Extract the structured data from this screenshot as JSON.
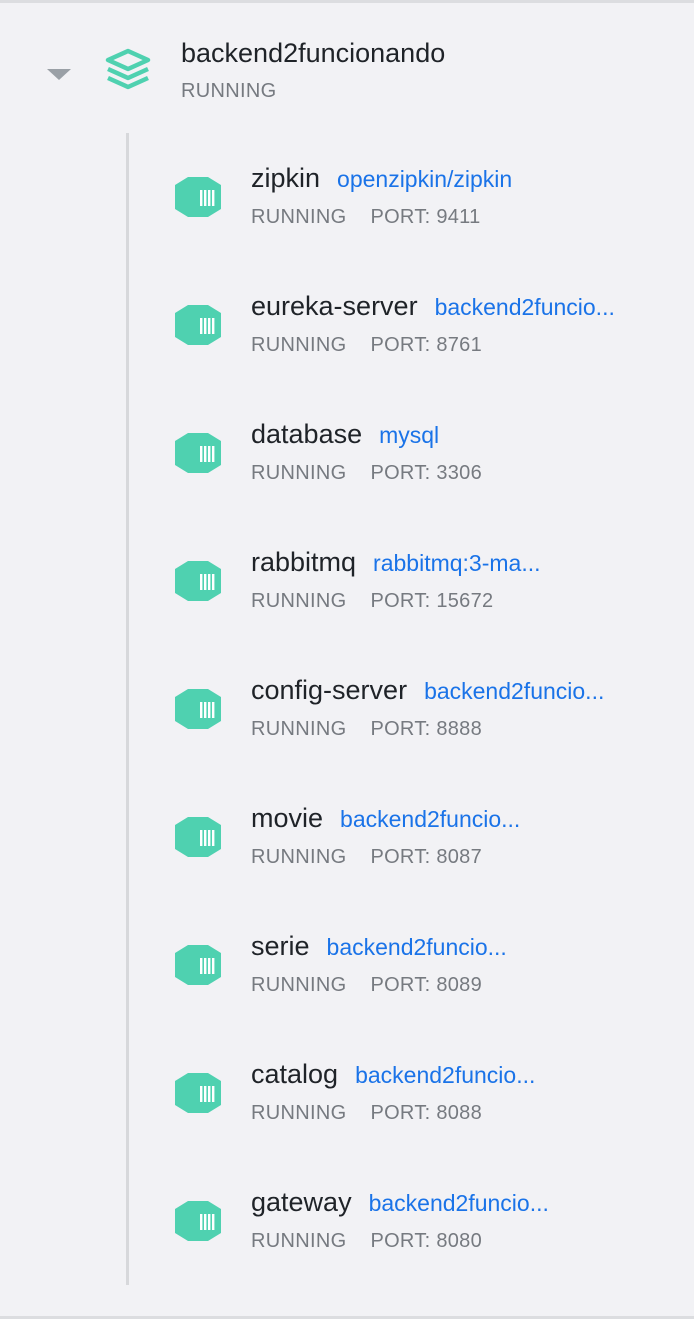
{
  "app": {
    "name": "backend2funcionando",
    "status": "RUNNING"
  },
  "colors": {
    "icon_accent": "#4fd1b0",
    "link": "#1a73e8",
    "muted_text": "#767a80",
    "background": "#f2f2f5"
  },
  "icons": {
    "expand": "chevron-down-icon",
    "app": "stack-layers-icon",
    "container": "container-icon"
  },
  "containers": [
    {
      "name": "zipkin",
      "image": "openzipkin/zipkin",
      "status": "RUNNING",
      "port": "PORT: 9411"
    },
    {
      "name": "eureka-server",
      "image": "backend2funcio...",
      "status": "RUNNING",
      "port": "PORT: 8761"
    },
    {
      "name": "database",
      "image": "mysql",
      "status": "RUNNING",
      "port": "PORT: 3306"
    },
    {
      "name": "rabbitmq",
      "image": "rabbitmq:3-ma...",
      "status": "RUNNING",
      "port": "PORT: 15672"
    },
    {
      "name": "config-server",
      "image": "backend2funcio...",
      "status": "RUNNING",
      "port": "PORT: 8888"
    },
    {
      "name": "movie",
      "image": "backend2funcio...",
      "status": "RUNNING",
      "port": "PORT: 8087"
    },
    {
      "name": "serie",
      "image": "backend2funcio...",
      "status": "RUNNING",
      "port": "PORT: 8089"
    },
    {
      "name": "catalog",
      "image": "backend2funcio...",
      "status": "RUNNING",
      "port": "PORT: 8088"
    },
    {
      "name": "gateway",
      "image": "backend2funcio...",
      "status": "RUNNING",
      "port": "PORT: 8080"
    }
  ]
}
